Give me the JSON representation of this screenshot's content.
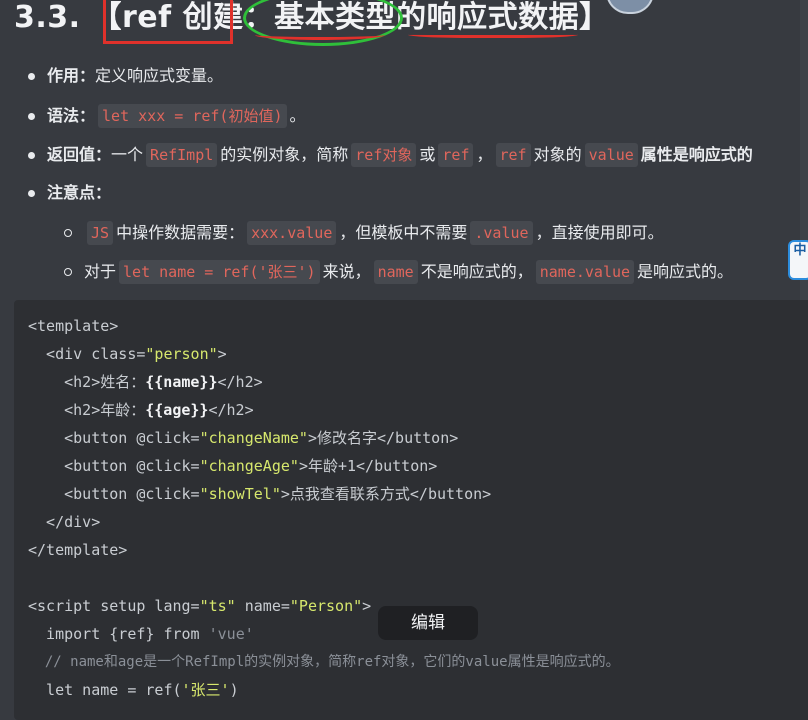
{
  "heading": {
    "number": "3.3.",
    "bracket_open": "【",
    "ref_create": "ref 创建",
    "colon": "：",
    "basic_types": "基本类型的",
    "reactive_data": "响应式数据",
    "bracket_close": "】"
  },
  "items": {
    "purpose": {
      "label": "作用",
      "sep": "：",
      "text": "定义响应式变量。"
    },
    "syntax": {
      "label": "语法",
      "sep": "：",
      "code": "let xxx = ref(初始值)",
      "after": "。"
    },
    "returns": {
      "label": "返回值",
      "sep": "：",
      "t1": "一个",
      "c1": "RefImpl",
      "t2": "的实例对象，简称",
      "c2": "ref对象",
      "t3": "或",
      "c3": "ref",
      "t4": "，",
      "c4": "ref",
      "t5": "对象的",
      "c5": "value",
      "t6": "属性是响应式的"
    },
    "notes": {
      "label": "注意点",
      "sep": "："
    },
    "note1": {
      "c1": "JS",
      "t1": "中操作数据需要：",
      "c2": "xxx.value",
      "t2": "，但模板中不需要",
      "c3": ".value",
      "t3": "，直接使用即可。"
    },
    "note2": {
      "t1": "对于",
      "c1": "let name = ref('张三')",
      "t2": "来说，",
      "c2": "name",
      "t3": "不是响应式的，",
      "c3": "name.value",
      "t4": "是响应式的。"
    }
  },
  "sidebar_badge": "中",
  "code": {
    "l1": "<template>",
    "l2a": "  <div class=",
    "l2b": "\"person\"",
    "l2c": ">",
    "l3a": "    <h2>姓名：",
    "l3b": "{{name}}",
    "l3c": "</h2>",
    "l4a": "    <h2>年龄：",
    "l4b": "{{age}}",
    "l4c": "</h2>",
    "l5a": "    <button @click=",
    "l5b": "\"changeName\"",
    "l5c": ">修改名字</button>",
    "l6a": "    <button @click=",
    "l6b": "\"changeAge\"",
    "l6c": ">年龄+1</button>",
    "l7a": "    <button @click=",
    "l7b": "\"showTel\"",
    "l7c": ">点我查看联系方式</button>",
    "l8": "  </div>",
    "l9": "</template>",
    "l10a": "<script setup lang=",
    "l10b": "\"ts\"",
    "l10c": " name=",
    "l10d": "\"Person\"",
    "l10e": ">",
    "l11a": "  import {ref} from ",
    "l11b": "'vue'",
    "l12": "  // name和age是一个RefImpl的实例对象，简称ref对象，它们的value属性是响应式的。",
    "l13a": "  let name = ref(",
    "l13b": "'张三'",
    "l13c": ")"
  },
  "tooltip": "编辑"
}
